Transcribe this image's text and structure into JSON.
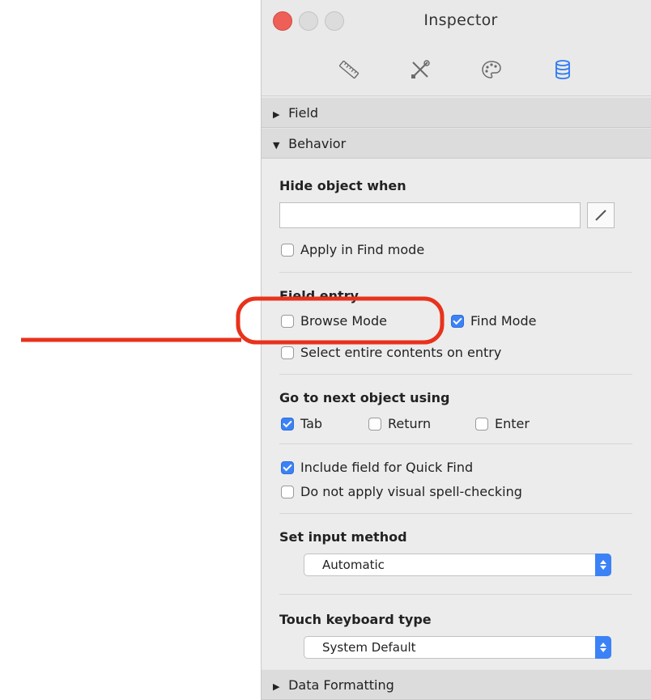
{
  "window": {
    "title": "Inspector"
  },
  "toolbar": {
    "tabs": [
      {
        "icon": "ruler-icon"
      },
      {
        "icon": "tools-icon"
      },
      {
        "icon": "palette-icon"
      },
      {
        "icon": "database-icon",
        "selected": true
      }
    ]
  },
  "sections": {
    "field": {
      "label": "Field",
      "expanded": false
    },
    "behavior": {
      "label": "Behavior",
      "expanded": true
    },
    "data_formatting": {
      "label": "Data Formatting",
      "expanded": false
    }
  },
  "behavior": {
    "hide_object_when": {
      "label": "Hide object when",
      "value": ""
    },
    "apply_in_find_mode": {
      "label": "Apply in Find mode",
      "checked": false
    },
    "field_entry": {
      "label": "Field entry",
      "browse_mode": {
        "label": "Browse Mode",
        "checked": false
      },
      "find_mode": {
        "label": "Find Mode",
        "checked": true
      },
      "select_entire": {
        "label": "Select entire contents on entry",
        "checked": false
      }
    },
    "go_to_next": {
      "label": "Go to next object using",
      "tab": {
        "label": "Tab",
        "checked": true
      },
      "return": {
        "label": "Return",
        "checked": false
      },
      "enter": {
        "label": "Enter",
        "checked": false
      }
    },
    "include_quick_find": {
      "label": "Include field for Quick Find",
      "checked": true
    },
    "no_spell_check": {
      "label": "Do not apply visual spell-checking",
      "checked": false
    },
    "input_method": {
      "label": "Set input method",
      "value": "Automatic"
    },
    "touch_keyboard": {
      "label": "Touch keyboard type",
      "value": "System Default"
    }
  },
  "colors": {
    "accent": "#3b82f6",
    "annotation": "#e8321c",
    "close_button": "#ed5f57"
  }
}
